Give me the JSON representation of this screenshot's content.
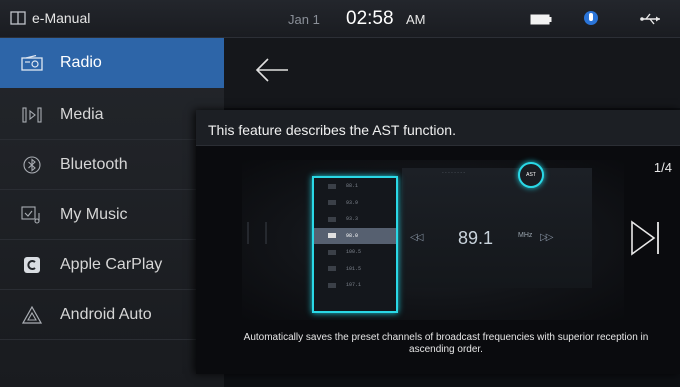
{
  "statusbar": {
    "app_title": "e-Manual",
    "date": "Jan 1",
    "time": "02:58",
    "ampm": "AM",
    "icons": [
      "book-icon",
      "battery-icon",
      "microphone-icon",
      "usb-icon"
    ]
  },
  "sidebar": {
    "items": [
      {
        "label": "Radio",
        "icon": "radio-icon",
        "active": true
      },
      {
        "label": "Media",
        "icon": "media-icon",
        "active": false
      },
      {
        "label": "Bluetooth",
        "icon": "bluetooth-icon",
        "active": false
      },
      {
        "label": "My Music",
        "icon": "my-music-icon",
        "active": false
      },
      {
        "label": "Apple CarPlay",
        "icon": "apple-carplay-icon",
        "active": false
      },
      {
        "label": "Android Auto",
        "icon": "android-auto-icon",
        "active": false
      }
    ]
  },
  "main": {
    "back_icon": "back-arrow-icon"
  },
  "popup": {
    "title": "This feature describes the AST function.",
    "page_indicator": "1/4",
    "caption": "Automatically saves the preset channels of broadcast frequencies with superior reception in ascending order.",
    "next_icon": "next-page-icon",
    "illustration": {
      "frequency": "89.1",
      "unit": "MHz",
      "ast_label": "AST",
      "presets": [
        "88.1",
        "93.9",
        "93.3",
        "98.0",
        "100.5",
        "101.5",
        "107.1"
      ],
      "selected_preset_index": 3
    }
  },
  "colors": {
    "accent_active": "#2d65a8",
    "highlight_cyan": "#2ad8e6",
    "background": "#0d0f13"
  }
}
